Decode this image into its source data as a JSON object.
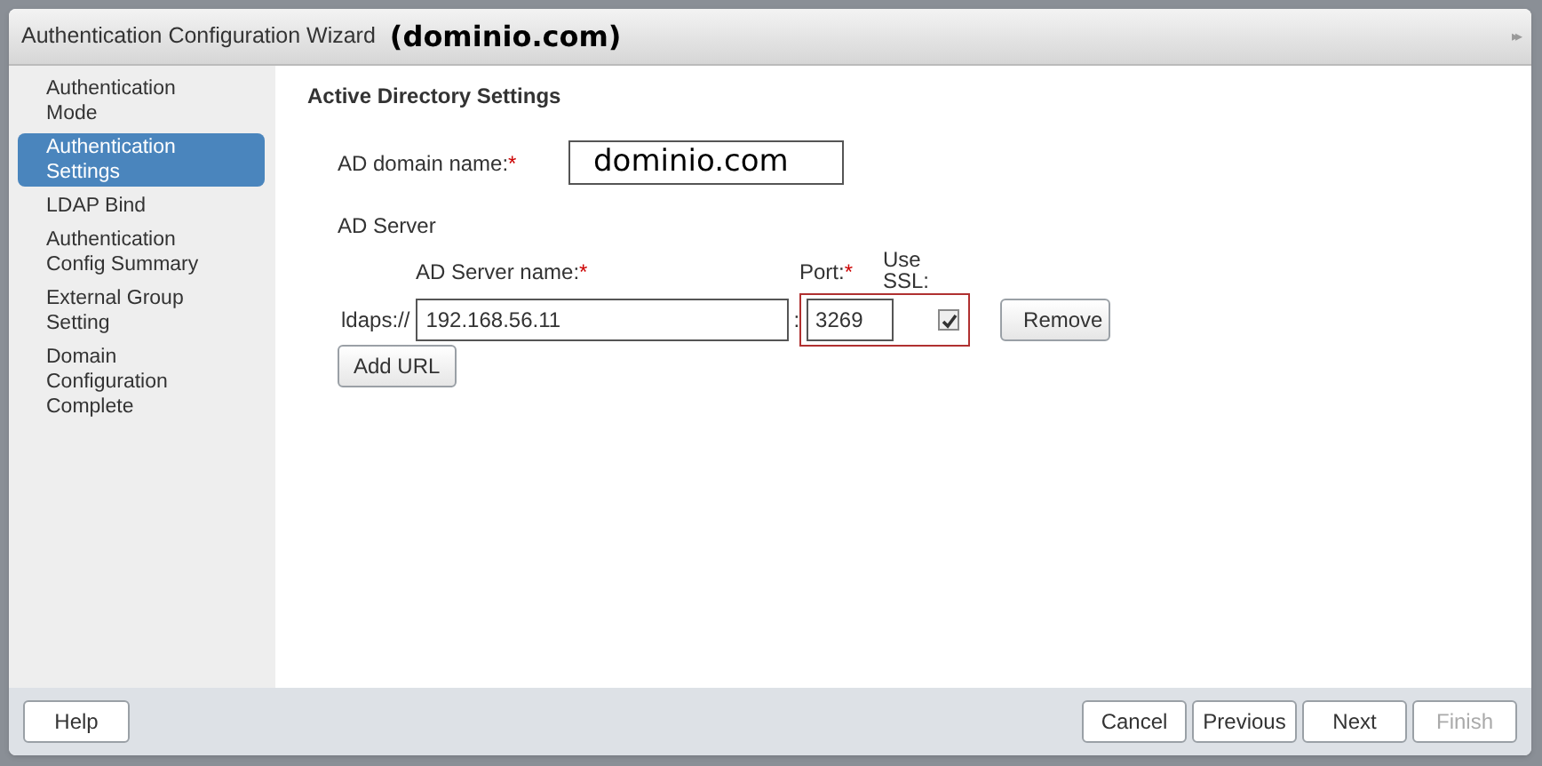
{
  "window": {
    "title": "Authentication Configuration Wizard",
    "subtitle": "(dominio.com)",
    "expand_icon": "▸▸"
  },
  "sidebar": {
    "items": [
      {
        "label": "Authentication Mode",
        "selected": false
      },
      {
        "label": "Authentication Settings",
        "selected": true
      },
      {
        "label": "LDAP Bind",
        "selected": false
      },
      {
        "label": "Authentication Config Summary",
        "selected": false
      },
      {
        "label": "External Group Setting",
        "selected": false
      },
      {
        "label": "Domain Configuration Complete",
        "selected": false
      }
    ]
  },
  "content": {
    "heading": "Active Directory Settings",
    "domain": {
      "label": "AD domain name:",
      "value": "dominio.com"
    },
    "server_section": "AD Server",
    "server_columns": {
      "name": "AD Server name:",
      "port": "Port:",
      "ssl": "Use SSL:",
      "required_mark": "*"
    },
    "servers": [
      {
        "prefix": "ldaps://",
        "separator": ":",
        "name": "192.168.56.11",
        "port": "3269",
        "ssl": true,
        "port_highlighted": true,
        "remove": "Remove"
      }
    ],
    "add_button": "Add URL"
  },
  "footer": {
    "buttons": [
      {
        "label": "Help",
        "kind": "left",
        "disabled": false
      },
      {
        "label": "Cancel",
        "kind": "right",
        "disabled": false
      },
      {
        "label": "Previous",
        "kind": "right",
        "disabled": false
      },
      {
        "label": "Next",
        "kind": "right",
        "disabled": false
      },
      {
        "label": "Finish",
        "kind": "right",
        "disabled": true
      }
    ]
  }
}
